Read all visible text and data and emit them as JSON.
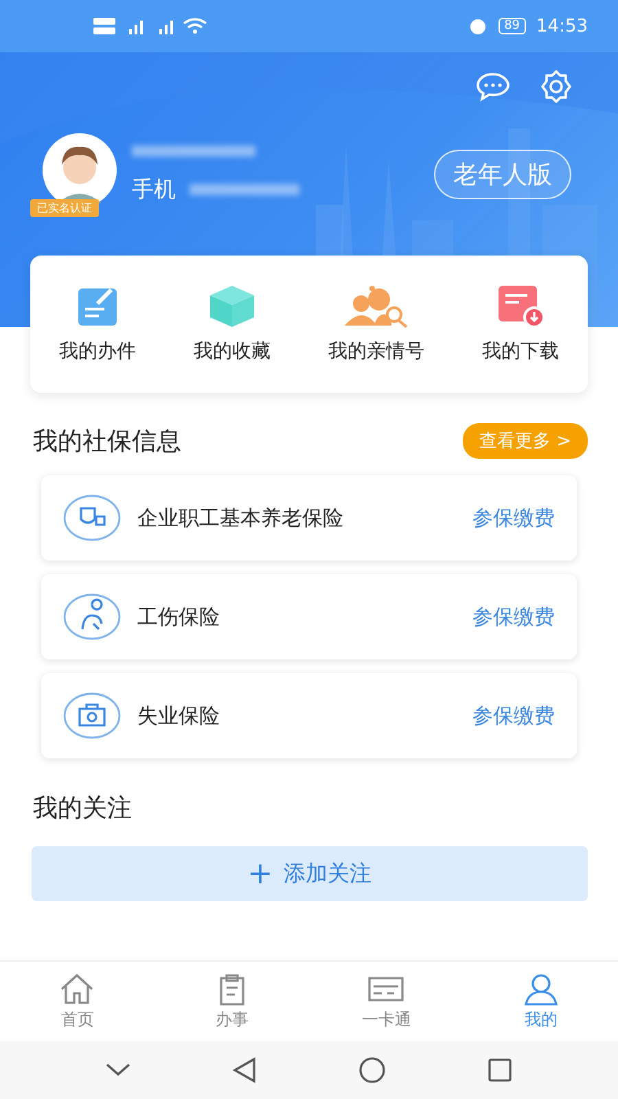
{
  "status_bar": {
    "time": "14:53",
    "battery": "89"
  },
  "header": {
    "phone_label": "手机",
    "verified_badge": "已实名认证",
    "elder_mode_button": "老年人版"
  },
  "shortcuts": [
    {
      "label": "我的办件",
      "kind": "edit"
    },
    {
      "label": "我的收藏",
      "kind": "box"
    },
    {
      "label": "我的亲情号",
      "kind": "family"
    },
    {
      "label": "我的下载",
      "kind": "download"
    }
  ],
  "social_security": {
    "title": "我的社保信息",
    "more_button": "查看更多 >",
    "items": [
      {
        "name": "企业职工基本养老保险",
        "kind": "pension",
        "action": "参保缴费"
      },
      {
        "name": "工伤保险",
        "kind": "injury",
        "action": "参保缴费"
      },
      {
        "name": "失业保险",
        "kind": "unemployment",
        "action": "参保缴费"
      }
    ]
  },
  "follows": {
    "title": "我的关注",
    "add_button": "添加关注",
    "add_icon": "+"
  },
  "tab_bar": [
    {
      "label": "首页",
      "kind": "home",
      "selected": false
    },
    {
      "label": "办事",
      "kind": "clipboard",
      "selected": false
    },
    {
      "label": "一卡通",
      "kind": "card",
      "selected": false
    },
    {
      "label": "我的",
      "kind": "person",
      "selected": true
    }
  ]
}
